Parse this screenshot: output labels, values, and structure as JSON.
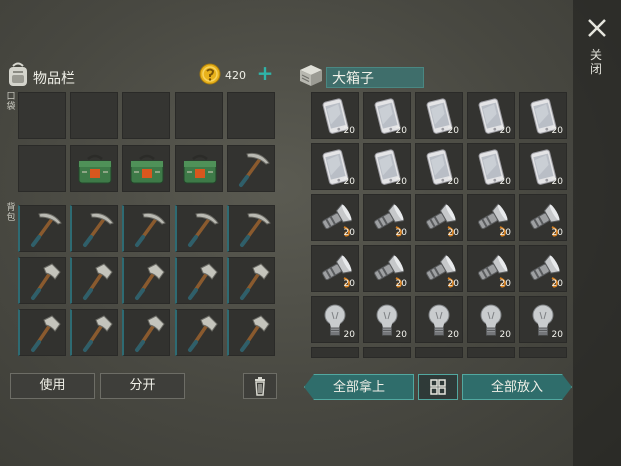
{
  "close": {
    "icon": "close-x-icon",
    "label": "关闭"
  },
  "inventory": {
    "title": "物品栏",
    "icon": "backpack-icon",
    "pocket_label": "口袋",
    "bag_label": "背包",
    "coins": {
      "icon": "coin-icon",
      "amount": "420",
      "add_icon": "plus-icon"
    },
    "pocket_slots": [
      {
        "item": "",
        "count": ""
      },
      {
        "item": "",
        "count": ""
      },
      {
        "item": "",
        "count": ""
      },
      {
        "item": "",
        "count": ""
      },
      {
        "item": "",
        "count": ""
      },
      {
        "item": "",
        "count": ""
      },
      {
        "item": "medkit-bag-icon",
        "count": ""
      },
      {
        "item": "medkit-bag-icon",
        "count": ""
      },
      {
        "item": "medkit-bag-icon",
        "count": ""
      },
      {
        "item": "pickaxe-icon",
        "count": ""
      }
    ],
    "backpack_slots": [
      {
        "item": "pickaxe-icon"
      },
      {
        "item": "pickaxe-icon"
      },
      {
        "item": "pickaxe-icon"
      },
      {
        "item": "pickaxe-icon"
      },
      {
        "item": "pickaxe-icon"
      },
      {
        "item": "hatchet-icon"
      },
      {
        "item": "hatchet-icon"
      },
      {
        "item": "hatchet-icon"
      },
      {
        "item": "hatchet-icon"
      },
      {
        "item": "hatchet-icon"
      },
      {
        "item": "hatchet-icon"
      },
      {
        "item": "hatchet-icon"
      },
      {
        "item": "hatchet-icon"
      },
      {
        "item": "hatchet-icon"
      },
      {
        "item": "hatchet-icon"
      }
    ],
    "buttons": {
      "use": "使用",
      "split": "分开",
      "trash_icon": "trash-icon"
    }
  },
  "chest": {
    "title": "大箱子",
    "icon": "chest-icon",
    "rows": [
      {
        "item": "phone-icon",
        "counts": [
          "20",
          "20",
          "20",
          "20",
          "20"
        ]
      },
      {
        "item": "phone-icon",
        "counts": [
          "20",
          "20",
          "20",
          "20",
          "20"
        ]
      },
      {
        "item": "flashlight-icon",
        "counts": [
          "20",
          "20",
          "20",
          "20",
          "20"
        ]
      },
      {
        "item": "flashlight-icon",
        "counts": [
          "20",
          "20",
          "20",
          "20",
          "20"
        ]
      },
      {
        "item": "lightbulb-icon",
        "counts": [
          "20",
          "20",
          "20",
          "20",
          "20"
        ]
      }
    ],
    "buttons": {
      "take_all": "全部拿上",
      "grid_icon": "grid-icon",
      "put_all": "全部放入"
    }
  },
  "colors": {
    "accent": "#2f6d6b",
    "accent_border": "#52a8a0",
    "plus": "#2fb3a8",
    "coin": "#e8b21c"
  }
}
